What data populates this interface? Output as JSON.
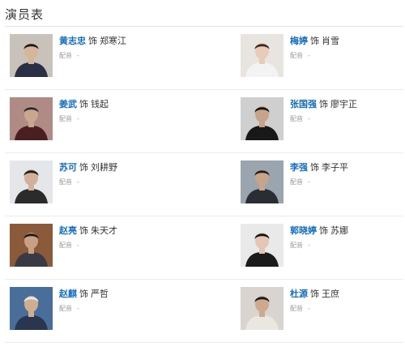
{
  "section": {
    "title": "演员表"
  },
  "cast": [
    {
      "actor": "黄志忠",
      "prefix": "饰",
      "role": "郑寒江",
      "dub_label": "配音",
      "dub_value": "-",
      "bg": "#c9c2ba",
      "skin": "#d7b59a",
      "hair": "#1a1a1a",
      "cloth": "#2a2f45"
    },
    {
      "actor": "梅婷",
      "prefix": "饰",
      "role": "肖雪",
      "dub_label": "配音",
      "dub_value": "-",
      "bg": "#e8e4e0",
      "skin": "#e8ccb8",
      "hair": "#3a2a22",
      "cloth": "#f3f3f3"
    },
    {
      "actor": "姜武",
      "prefix": "饰",
      "role": "钱起",
      "dub_label": "配音",
      "dub_value": "-",
      "bg": "#b08a84",
      "skin": "#c9a68e",
      "hair": "#2a2a2a",
      "cloth": "#4b1f22"
    },
    {
      "actor": "张国强",
      "prefix": "饰",
      "role": "廖宇正",
      "dub_label": "配音",
      "dub_value": "-",
      "bg": "#cfcfcf",
      "skin": "#c8a38a",
      "hair": "#151515",
      "cloth": "#181818"
    },
    {
      "actor": "苏可",
      "prefix": "饰",
      "role": "刘耕野",
      "dub_label": "配音",
      "dub_value": "-",
      "bg": "#e4e6ea",
      "skin": "#d2b099",
      "hair": "#1d1d1d",
      "cloth": "#2b2b2b"
    },
    {
      "actor": "李强",
      "prefix": "饰",
      "role": "李子平",
      "dub_label": "配音",
      "dub_value": "-",
      "bg": "#9aa5b0",
      "skin": "#c8a48b",
      "hair": "#202020",
      "cloth": "#2a2d33"
    },
    {
      "actor": "赵亮",
      "prefix": "饰",
      "role": "朱天才",
      "dub_label": "配音",
      "dub_value": "-",
      "bg": "#8a5a3a",
      "skin": "#c9a083",
      "hair": "#1a1a1a",
      "cloth": "#3a3a44"
    },
    {
      "actor": "郭晓婷",
      "prefix": "饰",
      "role": "苏娜",
      "dub_label": "配音",
      "dub_value": "-",
      "bg": "#e9e9e9",
      "skin": "#e3c6b4",
      "hair": "#141414",
      "cloth": "#1b1b1b"
    },
    {
      "actor": "赵麒",
      "prefix": "饰",
      "role": "严哲",
      "dub_label": "配音",
      "dub_value": "-",
      "bg": "#4a6e9a",
      "skin": "#d1ad92",
      "hair": "#e8e8e8",
      "cloth": "#2a3550"
    },
    {
      "actor": "杜源",
      "prefix": "饰",
      "role": "王庶",
      "dub_label": "配音",
      "dub_value": "-",
      "bg": "#d9d4cf",
      "skin": "#cfa98d",
      "hair": "#1a1a1a",
      "cloth": "#eae6e0"
    }
  ]
}
